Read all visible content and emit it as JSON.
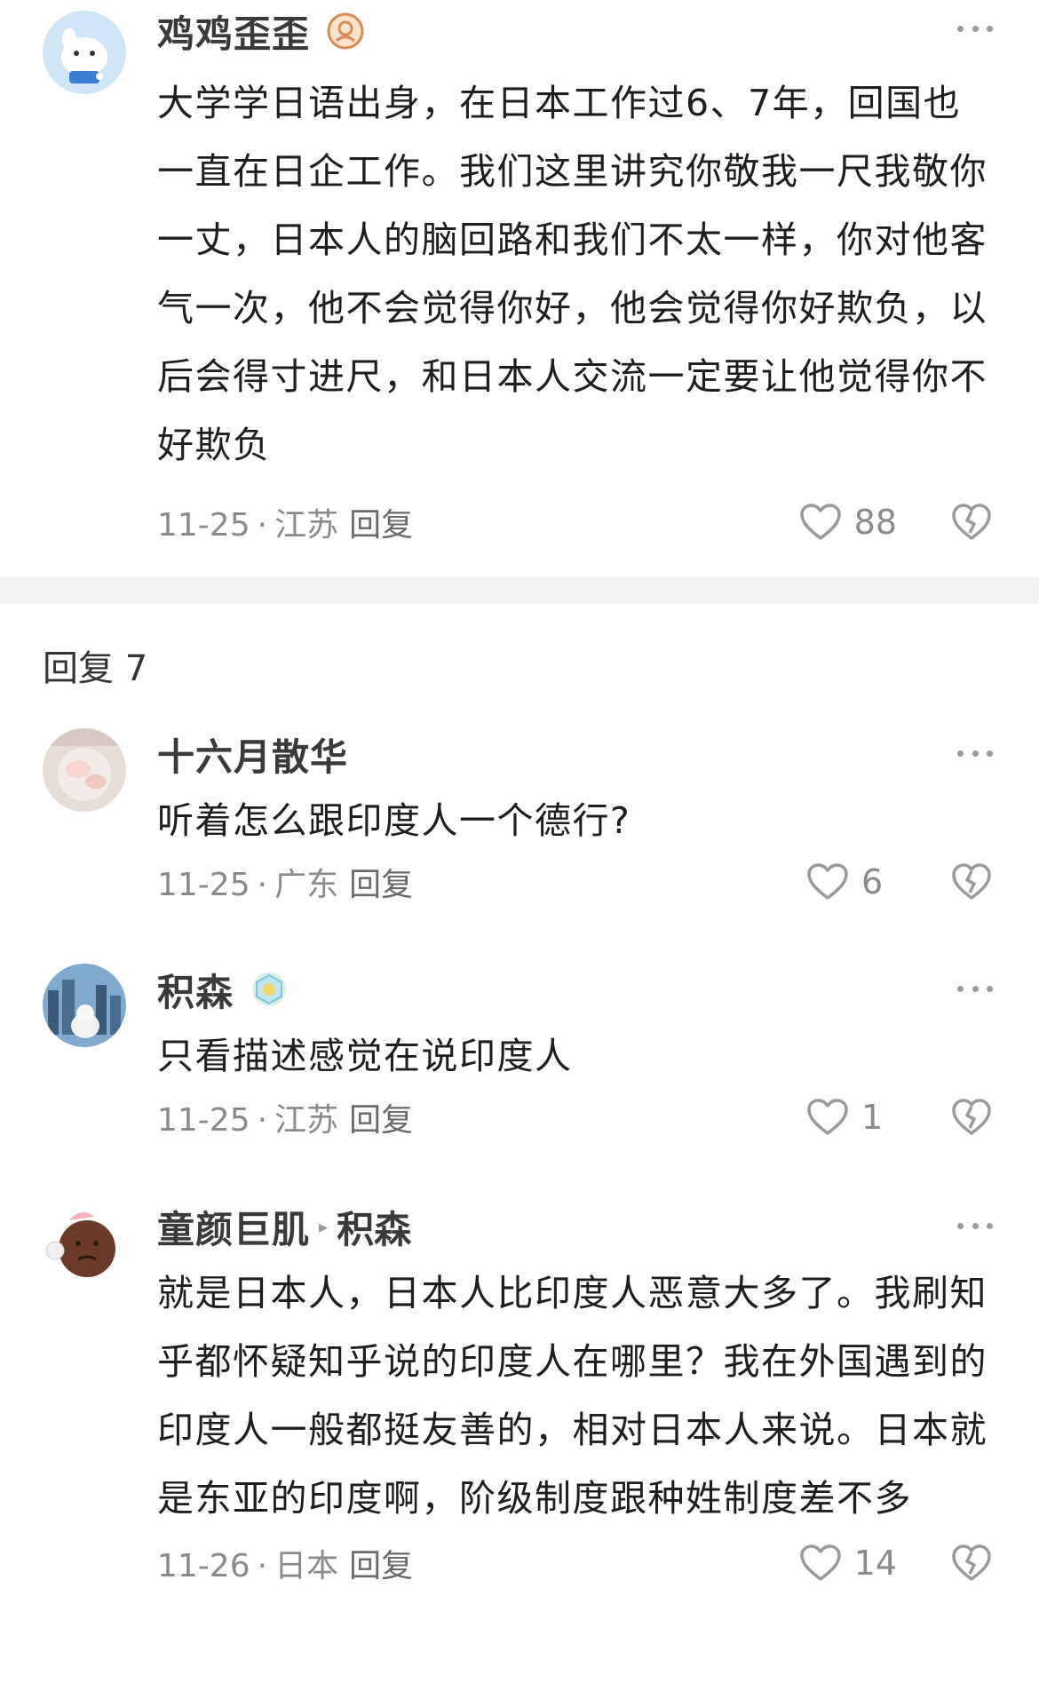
{
  "main_comment": {
    "username": "鸡鸡歪歪",
    "badge_icon": "creator-badge-icon",
    "text": "大学学日语出身，在日本工作过6、7年，回国也一直在日企工作。我们这里讲究你敬我一尺我敬你一丈，日本人的脑回路和我们不太一样，你对他客气一次，他不会觉得你好，他会觉得你好欺负，以后会得寸进尺，和日本人交流一定要让他觉得你不好欺负",
    "date": "11-25",
    "location": "江苏",
    "reply_label": "回复",
    "likes": "88"
  },
  "replies_header": "回复 7",
  "replies": [
    {
      "username": "十六月散华",
      "text": "听着怎么跟印度人一个德行?",
      "date": "11-25",
      "location": "广东",
      "reply_label": "回复",
      "likes": "6"
    },
    {
      "username": "积森",
      "text": "只看描述感觉在说印度人",
      "date": "11-25",
      "location": "江苏",
      "reply_label": "回复",
      "likes": "1"
    },
    {
      "username": "童颜巨肌",
      "reply_to": "积森",
      "text": "就是日本人，日本人比印度人恶意大多了。我刷知乎都怀疑知乎说的印度人在哪里？我在外国遇到的印度人一般都挺友善的，相对日本人来说。日本就是东亚的印度啊，阶级制度跟种姓制度差不多",
      "date": "11-26",
      "location": "日本",
      "reply_label": "回复",
      "likes": "14"
    }
  ],
  "separator": "·",
  "colors": {
    "text": "#1e1e1e",
    "muted": "#8a8a8a",
    "divider": "#f2f2f2"
  }
}
